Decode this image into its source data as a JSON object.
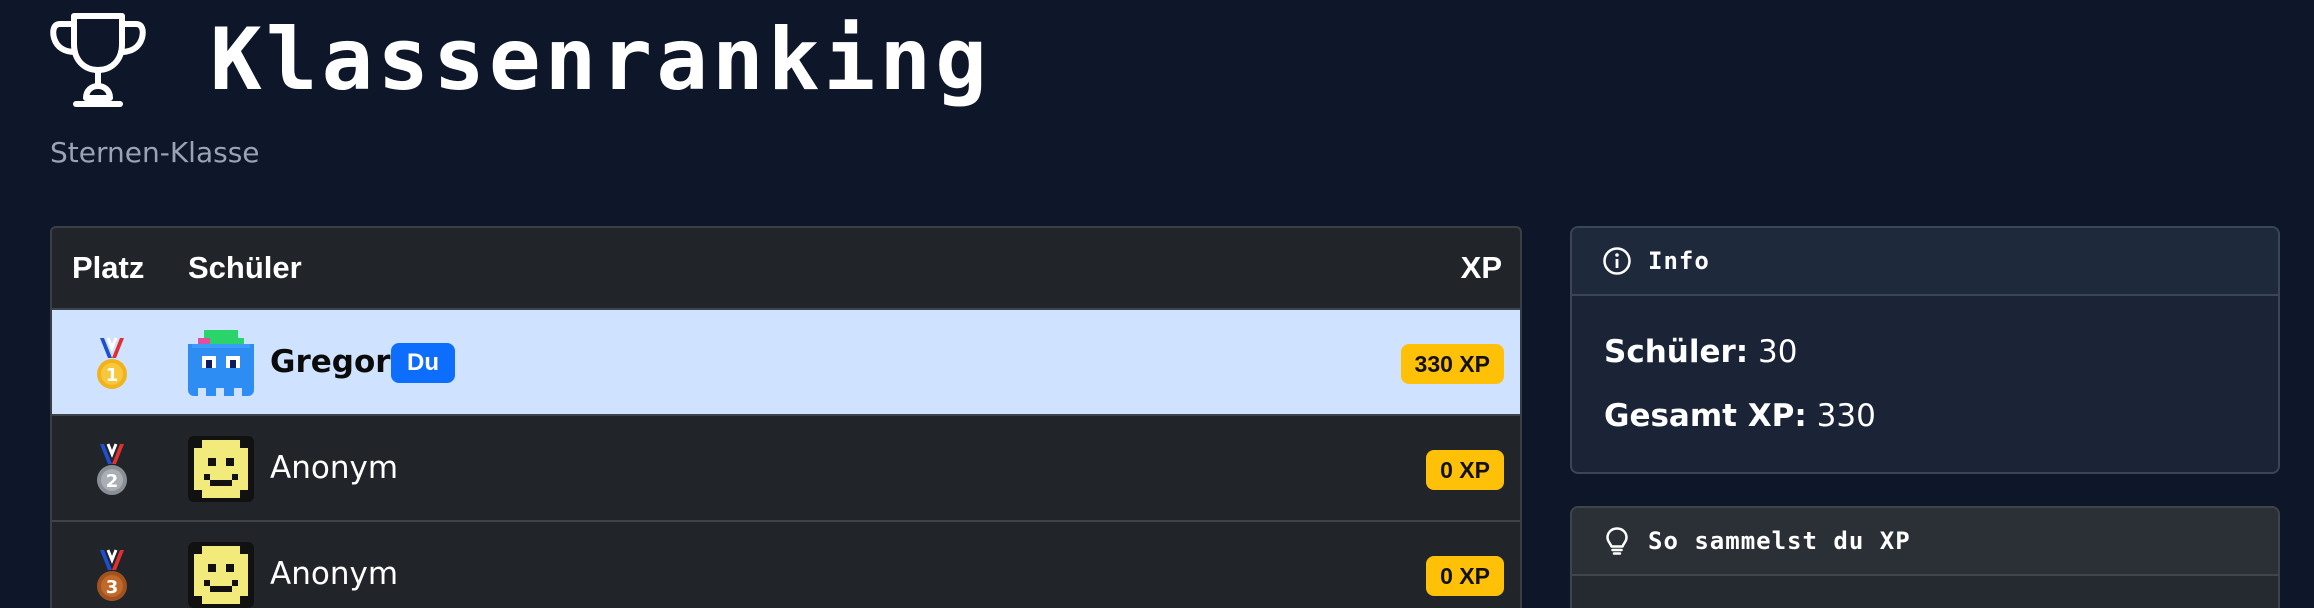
{
  "header": {
    "title": "Klassenranking",
    "subtitle": "Sternen-Klasse",
    "icon": "trophy-icon"
  },
  "table": {
    "columns": {
      "place": "Platz",
      "student": "Schüler",
      "xp": "XP"
    },
    "rows": [
      {
        "place": 1,
        "medal": "gold-medal-icon",
        "avatar": "blue-ghost-avatar",
        "name": "Gregor",
        "badge": "Du",
        "xp": "330 XP",
        "highlighted": true
      },
      {
        "place": 2,
        "medal": "silver-medal-icon",
        "avatar": "smiley-avatar",
        "name": "Anonym",
        "badge": "",
        "xp": "0 XP",
        "highlighted": false
      },
      {
        "place": 3,
        "medal": "bronze-medal-icon",
        "avatar": "smiley-avatar",
        "name": "Anonym",
        "badge": "",
        "xp": "0 XP",
        "highlighted": false
      }
    ]
  },
  "info_card": {
    "title": "Info",
    "icon": "info-icon",
    "students_label": "Schüler:",
    "students_value": "30",
    "total_xp_label": "Gesamt XP:",
    "total_xp_value": "330"
  },
  "xp_card": {
    "title": "So sammelst du XP",
    "icon": "lightbulb-icon"
  },
  "colors": {
    "background": "#0e1629",
    "highlight_row": "#cfe2ff",
    "you_badge": "#0d6efd",
    "xp_badge": "#ffc107"
  }
}
